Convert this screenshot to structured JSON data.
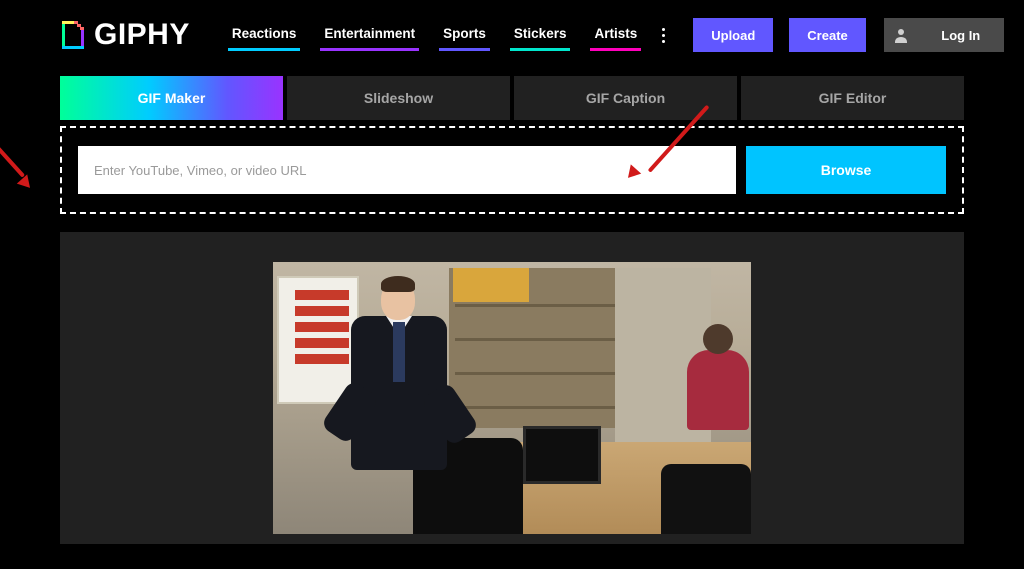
{
  "brand": "GIPHY",
  "nav": {
    "reactions": "Reactions",
    "entertainment": "Entertainment",
    "sports": "Sports",
    "stickers": "Stickers",
    "artists": "Artists"
  },
  "header_buttons": {
    "upload": "Upload",
    "create": "Create",
    "login": "Log In"
  },
  "tabs": {
    "gif_maker": "GIF Maker",
    "slideshow": "Slideshow",
    "gif_caption": "GIF Caption",
    "gif_editor": "GIF Editor"
  },
  "input": {
    "placeholder": "Enter YouTube, Vimeo, or video URL",
    "value": "",
    "browse": "Browse"
  }
}
